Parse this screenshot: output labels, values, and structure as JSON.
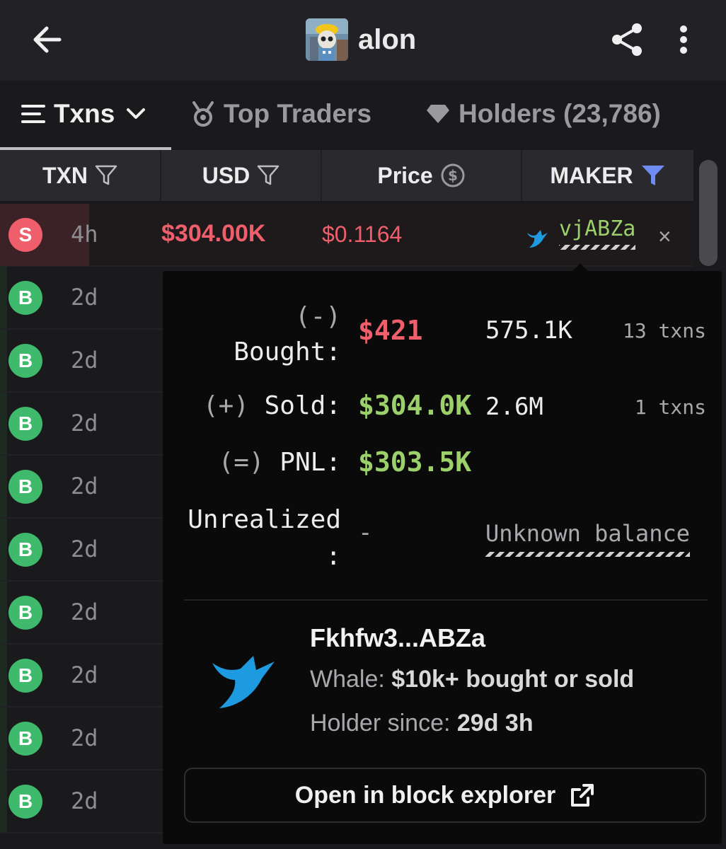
{
  "header": {
    "title": "alon",
    "back_icon": "arrow-left-icon",
    "share_icon": "share-icon",
    "more_icon": "more-vertical-icon"
  },
  "tabs": [
    {
      "label": "Txns",
      "icon": "list-icon",
      "active": true
    },
    {
      "label": "Top Traders",
      "icon": "medal-icon",
      "active": false
    },
    {
      "label": "Holders (23,786)",
      "icon": "diamond-icon",
      "active": false
    }
  ],
  "table": {
    "headers": {
      "txn": "TXN",
      "usd": "USD",
      "price": "Price",
      "maker": "MAKER"
    },
    "sell_row": {
      "type": "S",
      "age": "4h",
      "usd": "$304.00K",
      "price": "$0.1164",
      "maker": "vjABZa",
      "close": "×"
    },
    "buy_rows": [
      {
        "type": "B",
        "age": "2d"
      },
      {
        "type": "B",
        "age": "2d"
      },
      {
        "type": "B",
        "age": "2d"
      },
      {
        "type": "B",
        "age": "2d"
      },
      {
        "type": "B",
        "age": "2d"
      },
      {
        "type": "B",
        "age": "2d"
      },
      {
        "type": "B",
        "age": "2d"
      },
      {
        "type": "B",
        "age": "2d"
      },
      {
        "type": "B",
        "age": "2d"
      }
    ]
  },
  "popover": {
    "bought_prefix": "(-)",
    "bought_label": "Bought:",
    "bought_usd": "$421",
    "bought_qty": "575.1K",
    "bought_txns": "13 txns",
    "sold_prefix": "(+)",
    "sold_label": "Sold:",
    "sold_usd": "$304.0K",
    "sold_qty": "2.6M",
    "sold_txns": "1 txns",
    "pnl_prefix": "(=)",
    "pnl_label": "PNL:",
    "pnl_usd": "$303.5K",
    "unrealized_label": "Unrealized",
    "unrealized_colon": ":",
    "unrealized_value": "-",
    "unknown_balance": "Unknown balance",
    "wallet": {
      "address": "Fkhfw3...ABZa",
      "whale_prefix": "Whale: ",
      "whale_desc": "$10k+ bought or sold",
      "holder_prefix": "Holder since: ",
      "holder_since": "29d 3h"
    },
    "explorer_button": "Open in block explorer"
  },
  "colors": {
    "sell": "#ef5f6b",
    "buy": "#3fb96b",
    "gain": "#9bd06a",
    "filter_active": "#6e8cf2",
    "whale": "#1e9be0"
  }
}
